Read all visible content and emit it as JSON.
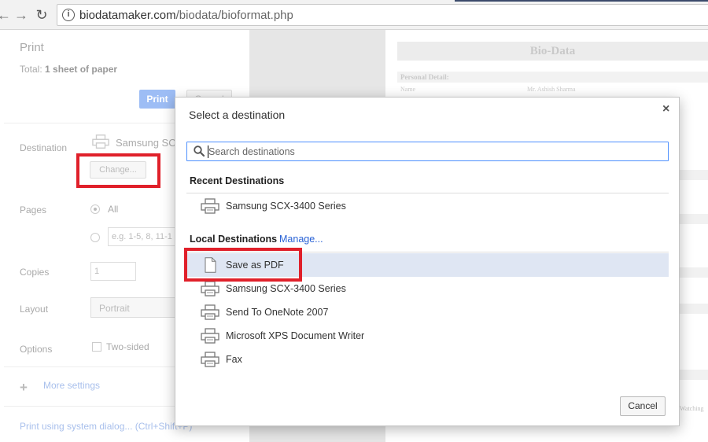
{
  "browser": {
    "back_icon": "←",
    "forward_icon": "→",
    "reload_icon": "↻",
    "info_icon": "i",
    "url_domain": "biodatamaker.com",
    "url_path": "/biodata/bioformat.php"
  },
  "print_panel": {
    "title": "Print",
    "total_label": "Total:",
    "total_value": "1 sheet of paper",
    "print_button": "Print",
    "cancel_button": "Cancel",
    "destination_label": "Destination",
    "printer_name": "Samsung SCX",
    "change_button": "Change...",
    "pages_label": "Pages",
    "pages_all": "All",
    "pages_placeholder": "e.g. 1-5, 8, 11-1",
    "copies_label": "Copies",
    "copies_value": "1",
    "layout_label": "Layout",
    "layout_value": "Portrait",
    "options_label": "Options",
    "two_sided_label": "Two-sided",
    "more_settings_icon": "+",
    "more_settings": "More settings",
    "system_dialog_link": "Print using system dialog... (Ctrl+Shift+P)"
  },
  "preview": {
    "doc_title": "Bio-Data",
    "section_title": "Personal Detail:",
    "name_label": "Name",
    "name_value": "Mr. Ashish Sharma",
    "watching_text": "Watching"
  },
  "dialog": {
    "title": "Select a destination",
    "close_icon": "×",
    "search_placeholder": "Search destinations",
    "recent_header": "Recent Destinations",
    "recent": [
      {
        "label": "Samsung SCX-3400 Series",
        "icon": "printer-icon"
      }
    ],
    "local_header": "Local Destinations",
    "manage_link": "Manage...",
    "local": [
      {
        "label": "Save as PDF",
        "icon": "document-icon",
        "selected": true
      },
      {
        "label": "Samsung SCX-3400 Series",
        "icon": "printer-icon"
      },
      {
        "label": "Send To OneNote 2007",
        "icon": "printer-icon"
      },
      {
        "label": "Microsoft XPS Document Writer",
        "icon": "printer-icon"
      },
      {
        "label": "Fax",
        "icon": "printer-icon"
      }
    ],
    "cancel_button": "Cancel"
  },
  "colors": {
    "annotation_red": "#e0202a",
    "link_blue": "#2962d6",
    "selected_row": "#dfe6f3",
    "search_focus": "#4d90fe"
  }
}
